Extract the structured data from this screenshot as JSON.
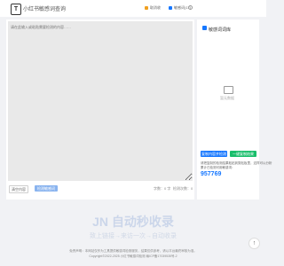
{
  "header": {
    "logo_text": "T",
    "title": "小红书敏感词查询",
    "tool1": "取消收",
    "tool2": "敏感词(17)",
    "colors": {
      "tool1_icon": "#f0a020",
      "tool2_icon": "#1677ff"
    }
  },
  "editor": {
    "placeholder": "请在此输入或粘贴需要检测的内容……",
    "clear_button": "清空内容",
    "detect_button": "检测敏感词",
    "char_count": "字数：0 字",
    "detect_count": "检测次数：0"
  },
  "sidebar": {
    "title": "敏感词词库",
    "empty_text": "暂无数据",
    "btn_export": "复制内容并检测",
    "btn_copy": "一键复制结果",
    "note1": "请把复制的检测结果粘贴到剪贴板里，这样可以分析",
    "note2": "累计已检测可用敏感词：",
    "total": "957769"
  },
  "footer": {
    "line1": "免责声明：本网站仅作为工具提供敏感词检测服务，结果仅供参考，请以平台最终审核为准。",
    "line2": "Copyright©2022-2025 小红书敏感词检测   赣ICP备17039535号-2"
  },
  "watermark": {
    "main": "JN 自动秒收录",
    "sub": "致上链接→来访一次→自动收录"
  },
  "fab_symbol": "↑"
}
